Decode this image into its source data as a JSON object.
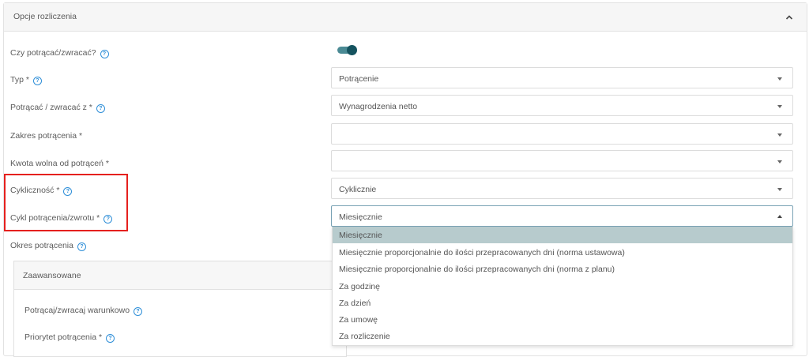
{
  "panel": {
    "title": "Opcje rozliczenia"
  },
  "fields": {
    "deduct_toggle": {
      "label": "Czy potrącać/zwracać?",
      "on": true
    },
    "type": {
      "label": "Typ *",
      "value": "Potrącenie"
    },
    "deduct_from": {
      "label": "Potrącać / zwracać z *",
      "value": "Wynagrodzenia netto"
    },
    "range": {
      "label": "Zakres potrącenia *",
      "value": ""
    },
    "free_amount": {
      "label": "Kwota wolna od potrąceń *",
      "value": ""
    },
    "cyclicity": {
      "label": "Cykliczność *",
      "value": "Cyklicznie"
    },
    "cycle": {
      "label": "Cykl potrącenia/zwrotu *",
      "value": "Miesięcznie"
    },
    "period": {
      "label": "Okres potrącenia"
    }
  },
  "advanced": {
    "title": "Zaawansowane",
    "conditional_label": "Potrącaj/zwracaj warunkowo",
    "priority_label": "Priorytet potrącenia *"
  },
  "dropdown": {
    "options": [
      "Miesięcznie",
      "Miesięcznie proporcjonalnie do ilości przepracowanych dni (norma ustawowa)",
      "Miesięcznie proporcjonalnie do ilości przepracowanych dni (norma z planu)",
      "Za godzinę",
      "Za dzień",
      "Za umowę",
      "Za rozliczenie"
    ],
    "selected_index": 0
  },
  "colors": {
    "toggle_on": "#15535f",
    "highlight": "#e5201e",
    "help": "#2f8fd8",
    "selected_option": "#b7cbcd"
  }
}
